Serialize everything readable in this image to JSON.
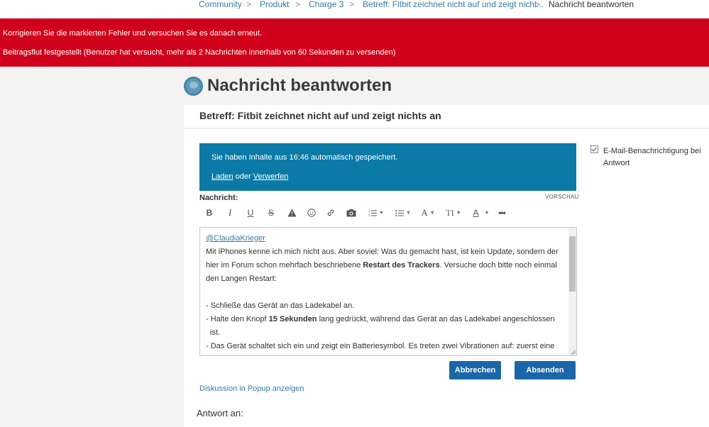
{
  "breadcrumb": {
    "items": [
      "Community",
      "Produkt",
      "Charge 3",
      "Betreff: Fitbit zeichnet nicht auf und zeigt nicht..."
    ],
    "current": "Nachricht beantworten",
    "separator": ">"
  },
  "errors": {
    "line1": "Korrigieren Sie die markierten Fehler und versuchen Sie es danach erneut.",
    "line2": "Beitragsflut festgestellt (Benutzer hat versucht, mehr als 2 Nachrichten innerhalb von 60 Sekunden zu versenden)"
  },
  "page": {
    "title": "Nachricht beantworten",
    "subject": "Betreff: Fitbit zeichnet nicht auf und zeigt nichts an"
  },
  "autosave": {
    "message": "Sie haben Inhalte aus 16:46 automatisch gespeichert.",
    "load_label": "Laden",
    "or_label": "oder",
    "discard_label": "Verwerfen"
  },
  "editor": {
    "label": "Nachricht:",
    "preview_label": "VORSCHAU",
    "mention": "@ClaudiaKrieger",
    "para1_a": "Mit iPhones kenne ich mich nicht aus. Aber soviel: Was du gemacht hast, ist kein Update, sondern der hier im Forum schon mehrfach beschriebene ",
    "para1_bold": "Restart des Trackers",
    "para1_b": ". Versuche doch bitte noch einmal den Langen Restart:",
    "step1": "- Schließe das Gerät an das Ladekabel an.",
    "step2_a": "- Halte den Knopf ",
    "step2_bold": "15 Sekunden",
    "step2_b": " lang gedrückt, während das Gerät an das Ladekabel angeschlossen",
    "step2_c": "ist.",
    "step3": "- Das Gerät schaltet sich ein und zeigt ein Batteriesymbol. Es treten zwei Vibrationen auf: zuerst eine"
  },
  "toolbar": {
    "bold": "B",
    "italic": "I",
    "underline": "U",
    "strike": "S",
    "font_size": "A",
    "text_style": "TI",
    "font_color": "A"
  },
  "buttons": {
    "cancel": "Abbrechen",
    "submit": "Absenden"
  },
  "links": {
    "popup": "Diskussion in Popup anzeigen"
  },
  "reply_to": {
    "label": "Antwort an:"
  },
  "notification": {
    "checked": true,
    "label": "E-Mail-Benachrichtigung bei Antwort"
  },
  "colors": {
    "error_red": "#d0021b",
    "autosave_blue": "#0b7aa6",
    "button_blue": "#1b66a8",
    "link_blue": "#3a7aa3"
  }
}
